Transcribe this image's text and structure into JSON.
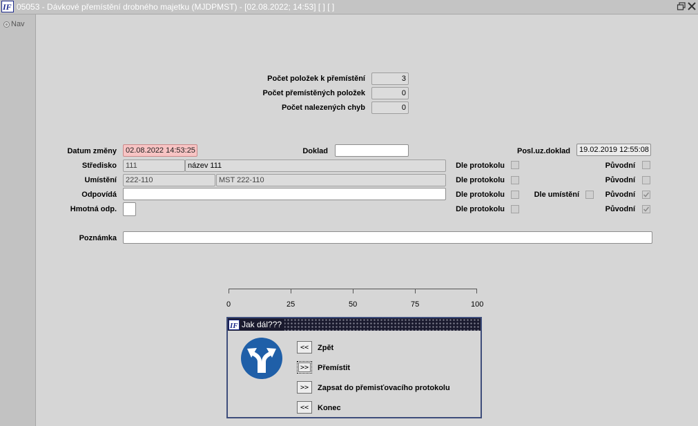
{
  "window": {
    "title": "05053 - Dávkové přemístění drobného majetku (MJDPMST) - [02.08.2022; 14:53]  [ ]  [ ]"
  },
  "sidebar": {
    "nav_label": "Nav"
  },
  "summary": {
    "items_to_move_label": "Počet položek k přemístění",
    "items_to_move_value": "3",
    "moved_items_label": "Počet přemístěných položek",
    "moved_items_value": "0",
    "errors_found_label": "Počet nalezených chyb",
    "errors_found_value": "0"
  },
  "form": {
    "change_date_label": "Datum změny",
    "change_date_value": "02.08.2022 14:53:25",
    "document_label": "Doklad",
    "document_value": "",
    "last_doc_label": "Posl.uz.doklad",
    "last_doc_value": "19.02.2019 12:55:08",
    "center_label": "Středisko",
    "center_code": "111",
    "center_name": "název 111",
    "location_label": "Umístění",
    "location_code": "222-110",
    "location_name": "MST 222-110",
    "responsible_label": "Odpovídá",
    "responsible_value": "",
    "material_resp_label": "Hmotná odp.",
    "material_resp_value": "",
    "note_label": "Poznámka",
    "note_value": "",
    "by_protocol_label": "Dle protokolu",
    "original_label": "Původní",
    "by_location_label": "Dle umístění",
    "checkboxes": {
      "center_protocol": false,
      "center_original": false,
      "location_protocol": false,
      "location_original": false,
      "responsible_protocol": false,
      "responsible_by_location": false,
      "responsible_original": true,
      "material_protocol": false,
      "material_original": true
    }
  },
  "progress": {
    "value_percent": 0,
    "ticks": [
      "0",
      "25",
      "50",
      "75",
      "100"
    ]
  },
  "dialog": {
    "title": "Jak dál???",
    "options": [
      {
        "button": "<<",
        "label": "Zpět"
      },
      {
        "button": ">>",
        "label": "Přemístit"
      },
      {
        "button": ">>",
        "label": "Zapsat do přemisťovacího protokolu"
      },
      {
        "button": "<<",
        "label": "Konec"
      }
    ]
  },
  "colors": {
    "background": "#d6d6d6",
    "date_highlight": "#f8c4c4",
    "sign_blue": "#1f5fa8",
    "dialog_border": "#3e4d7b"
  },
  "icons": {
    "app": "app-logo-icon",
    "sign": "direction-sign-icon",
    "restore": "restore-window-icon",
    "close": "close-icon"
  }
}
